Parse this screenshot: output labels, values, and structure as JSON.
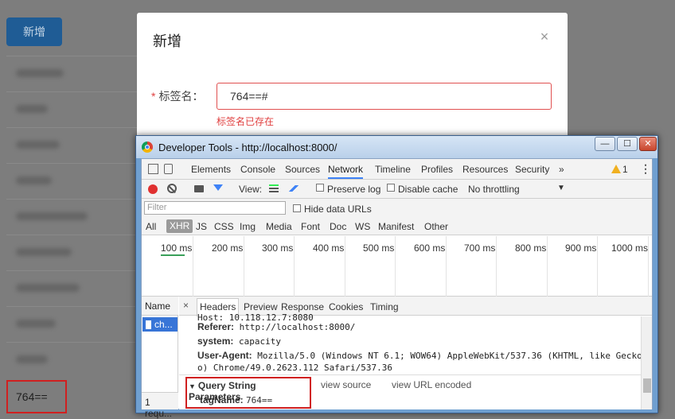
{
  "background_page": {
    "add_button": "新增",
    "last_row_value": "764=="
  },
  "modal": {
    "title": "新增",
    "close_symbol": "×",
    "required_mark": "*",
    "field_label": "标签名：",
    "field_value": "764==#",
    "error_message": "标签名已存在"
  },
  "devtools": {
    "window_title": "Developer Tools - http://localhost:8000/",
    "window_buttons": {
      "minimize": "—",
      "maximize": "☐",
      "close": "✕"
    },
    "panel_tabs": [
      "Elements",
      "Console",
      "Sources",
      "Network",
      "Timeline",
      "Profiles",
      "Resources",
      "Security"
    ],
    "more_tabs": "»",
    "active_panel": "Network",
    "warning_count": "1",
    "menu": "⋮",
    "toolbar": {
      "view_label": "View:",
      "preserve_log": "Preserve log",
      "disable_cache": "Disable cache",
      "throttling": "No throttling",
      "throttle_arrow": "▼"
    },
    "filter_placeholder": "Filter",
    "hide_data_urls": "Hide data URLs",
    "type_filters": [
      "All",
      "XHR",
      "JS",
      "CSS",
      "Img",
      "Media",
      "Font",
      "Doc",
      "WS",
      "Manifest",
      "Other"
    ],
    "active_type": "XHR",
    "timeline_ticks": [
      "100 ms",
      "200 ms",
      "300 ms",
      "400 ms",
      "500 ms",
      "600 ms",
      "700 ms",
      "800 ms",
      "900 ms",
      "1000 ms"
    ],
    "name_header": "Name",
    "request_name": "ch...",
    "summary": "1 requ...",
    "detail_close": "×",
    "detail_tabs": [
      "Headers",
      "Preview",
      "Response",
      "Cookies",
      "Timing"
    ],
    "active_detail_tab": "Headers",
    "headers": {
      "partial_top": "Host: 10.118.12.7:8080",
      "referer_key": "Referer:",
      "referer_val": "http://localhost:8000/",
      "system_key": "system:",
      "system_val": "capacity",
      "ua_key": "User-Agent:",
      "ua_val_1": "Mozilla/5.0 (Windows NT 6.1; WOW64) AppleWebKit/537.36 (KHTML, like Gecko",
      "ua_val_2": "o) Chrome/49.0.2623.112 Safari/537.36"
    },
    "query_string": {
      "toggle": "▼",
      "title": "Query String Parameters",
      "view_source": "view source",
      "view_url_encoded": "view URL encoded",
      "param_key": "tagName:",
      "param_value": "764=="
    }
  }
}
